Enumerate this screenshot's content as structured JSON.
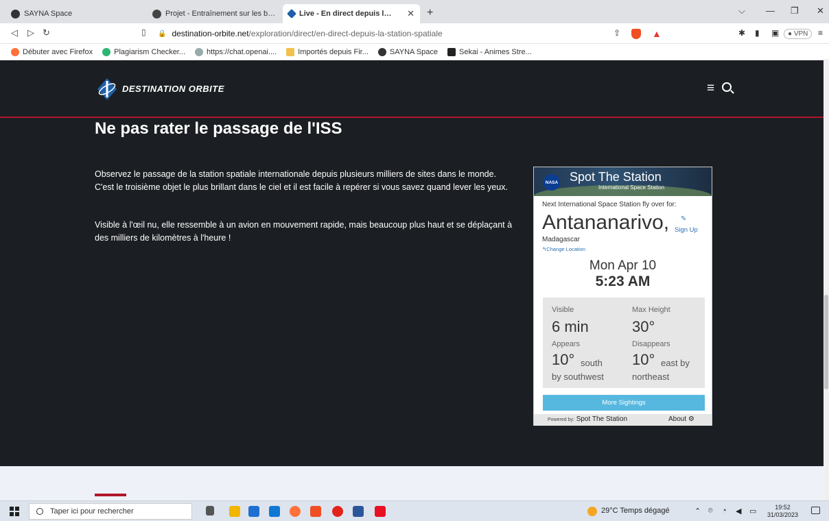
{
  "browser": {
    "tabs": [
      {
        "title": "SAYNA Space",
        "active": false
      },
      {
        "title": "Projet - Entraînement sur les bases d'i",
        "active": false
      },
      {
        "title": "Live - En direct depuis l'ISS",
        "active": true
      }
    ],
    "address": {
      "host": "destination-orbite.net",
      "path": "/exploration/direct/en-direct-depuis-la-station-spatiale"
    },
    "vpn_label": "● VPN",
    "bookmarks": [
      "Débuter avec Firefox",
      "Plagiarism Checker...",
      "https://chat.openai....",
      "Importés depuis Fir...",
      "SAYNA Space",
      "Sekai - Animes Stre..."
    ]
  },
  "site": {
    "brand": "DESTINATION ORBITE",
    "heading": "Ne pas rater le passage de l'ISS",
    "paragraphs": [
      "Observez le passage de la station spatiale internationale depuis plusieurs milliers de sites dans le monde. C'est le troisième objet le plus brillant dans le ciel et il est facile à repérer si vous savez quand lever les yeux.",
      "Visible à l'œil nu, elle ressemble à un avion en mouvement rapide, mais beaucoup plus haut et se déplaçant à des milliers de kilomètres à l'heure !"
    ]
  },
  "widget": {
    "nasa_label": "NASA",
    "title": "Spot The Station",
    "subtitle": "International Space Station",
    "next_label": "Next International Space Station fly over for:",
    "city": "Antananarivo,",
    "sign_up": "Sign Up",
    "country": "Madagascar",
    "change_location": "Change Location",
    "date": "Mon Apr 10",
    "time": "5:23 AM",
    "visible_label": "Visible",
    "visible_value": "6 min",
    "max_height_label": "Max Height",
    "max_height_value": "30°",
    "appears_label": "Appears",
    "appears_value": "10°",
    "appears_dir_1": "south",
    "appears_dir_2": "by southwest",
    "disappears_label": "Disappears",
    "disappears_value": "10°",
    "disappears_dir_1": "east by",
    "disappears_dir_2": "northeast",
    "more_button": "More Sightings",
    "powered_by": "Powered by:",
    "powered_name": "Spot The Station",
    "about": "About"
  },
  "taskbar": {
    "search_placeholder": "Taper ici pour rechercher",
    "weather": "29°C  Temps dégagé",
    "time": "19:52",
    "date": "31/03/2023"
  },
  "colors": {
    "page_bg": "#1b1e22",
    "accent_red": "#b0162a",
    "widget_button": "#56b8df"
  }
}
